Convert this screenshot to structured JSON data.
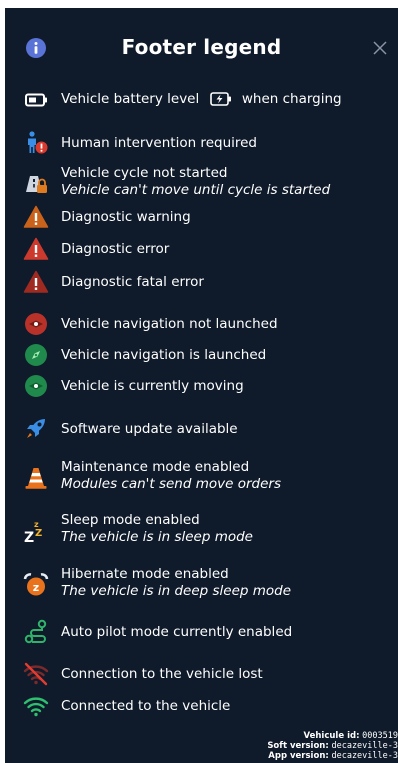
{
  "header": {
    "title": "Footer legend",
    "info_icon": "info-icon",
    "close_icon": "close-icon"
  },
  "legend": {
    "battery": {
      "label_before": "Vehicle battery level",
      "label_after": "when charging",
      "icon": "battery-icon",
      "charging_icon": "battery-charging-icon"
    },
    "human": {
      "label": "Human intervention required",
      "icon": "person-alert-icon"
    },
    "cycle": {
      "label": "Vehicle cycle not started",
      "sub": "Vehicle can't move until cycle is started",
      "icon": "vehicle-locked-icon"
    },
    "diag_warning": {
      "label": "Diagnostic warning",
      "icon": "warning-orange-icon",
      "color": "#e07a1f"
    },
    "diag_error": {
      "label": "Diagnostic error",
      "icon": "warning-red-icon",
      "color": "#d93a2e"
    },
    "diag_fatal": {
      "label": "Diagnostic fatal error",
      "icon": "warning-darkred-icon",
      "color": "#a4291f"
    },
    "nav_not_launched": {
      "label": "Vehicle navigation not launched",
      "icon": "navigation-red-icon",
      "color": "#c0392b"
    },
    "nav_launched": {
      "label": "Vehicle navigation is launched",
      "icon": "navigation-green-icon",
      "color": "#27ae60"
    },
    "moving": {
      "label": "Vehicle is currently moving",
      "icon": "moving-green-icon",
      "color": "#27ae60"
    },
    "software": {
      "label": "Software update available",
      "icon": "rocket-icon"
    },
    "maintenance": {
      "label": "Maintenance mode enabled",
      "sub": "Modules can't send move orders",
      "icon": "traffic-cone-icon"
    },
    "sleep": {
      "label": "Sleep mode enabled",
      "sub": "The vehicle is in sleep mode",
      "icon": "sleep-zzz-icon"
    },
    "hibernate": {
      "label": "Hibernate mode enabled",
      "sub": "The vehicle is in deep sleep mode",
      "icon": "alarm-clock-icon"
    },
    "autopilot": {
      "label": "Auto pilot mode currently enabled",
      "icon": "route-icon"
    },
    "conn_lost": {
      "label": "Connection to the vehicle lost",
      "icon": "wifi-off-icon"
    },
    "connected": {
      "label": "Connected to the vehicle",
      "icon": "wifi-icon"
    }
  },
  "footer": {
    "vehicle_id_label": "Vehicule id:",
    "vehicle_id_value": "0003519",
    "soft_version_label": "Soft version:",
    "soft_version_value": "decazeville-3",
    "app_version_label": "App version:",
    "app_version_value": "decazeville-3"
  },
  "colors": {
    "background": "#0f1a2a",
    "text": "#ffffff",
    "accent_green": "#27ae60",
    "accent_red": "#c0392b",
    "accent_orange": "#e07a1f",
    "accent_blue": "#3a8ee6"
  }
}
